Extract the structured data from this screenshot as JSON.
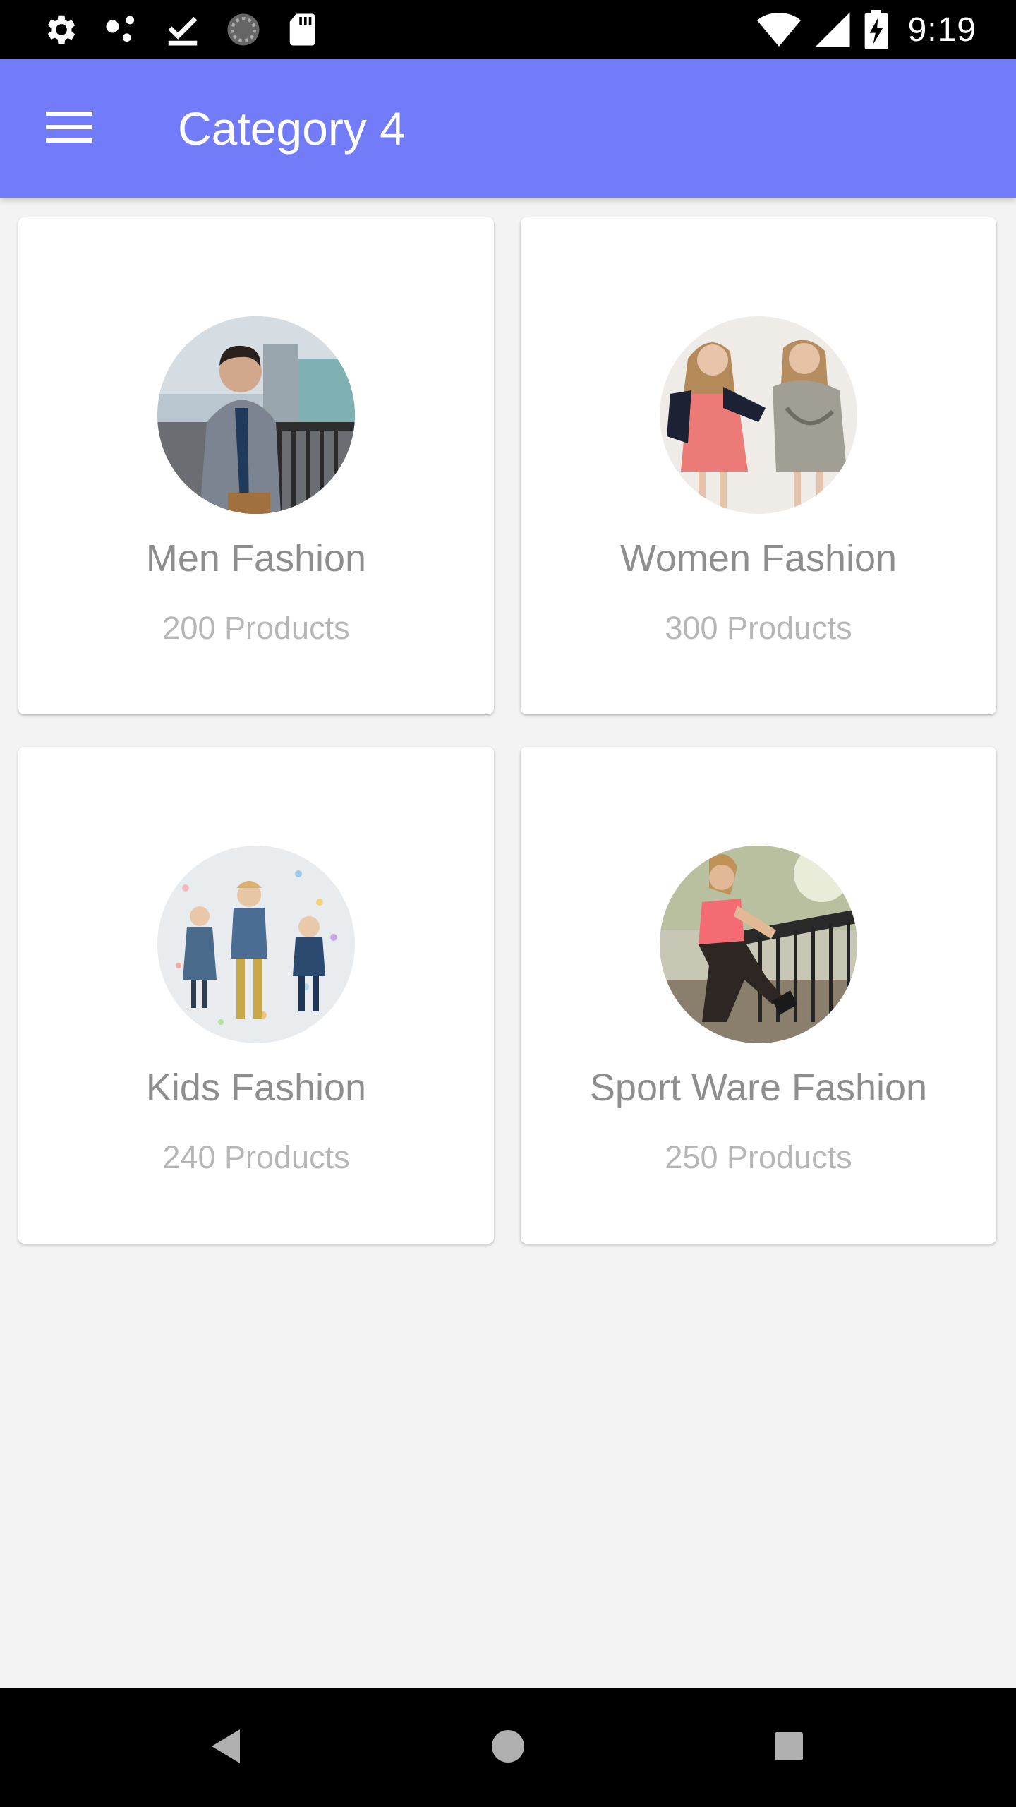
{
  "status_bar": {
    "time": "9:19",
    "icons": [
      "settings-icon",
      "share-dots-icon",
      "download-done-icon",
      "sync-circle-icon",
      "sd-card-icon",
      "wifi-icon",
      "signal-icon",
      "battery-charging-icon"
    ]
  },
  "app_bar": {
    "title": "Category 4",
    "menu_icon": "hamburger-menu-icon",
    "background_color": "#737cf8"
  },
  "categories": [
    {
      "title": "Men Fashion",
      "count": "200 Products",
      "image": "men-fashion-photo"
    },
    {
      "title": "Women Fashion",
      "count": "300 Products",
      "image": "women-fashion-photo"
    },
    {
      "title": "Kids Fashion",
      "count": "240 Products",
      "image": "kids-fashion-photo"
    },
    {
      "title": "Sport Ware Fashion",
      "count": "250 Products",
      "image": "sport-fashion-photo"
    }
  ],
  "nav_bar": {
    "buttons": [
      "back-icon",
      "home-icon",
      "recents-icon"
    ]
  }
}
